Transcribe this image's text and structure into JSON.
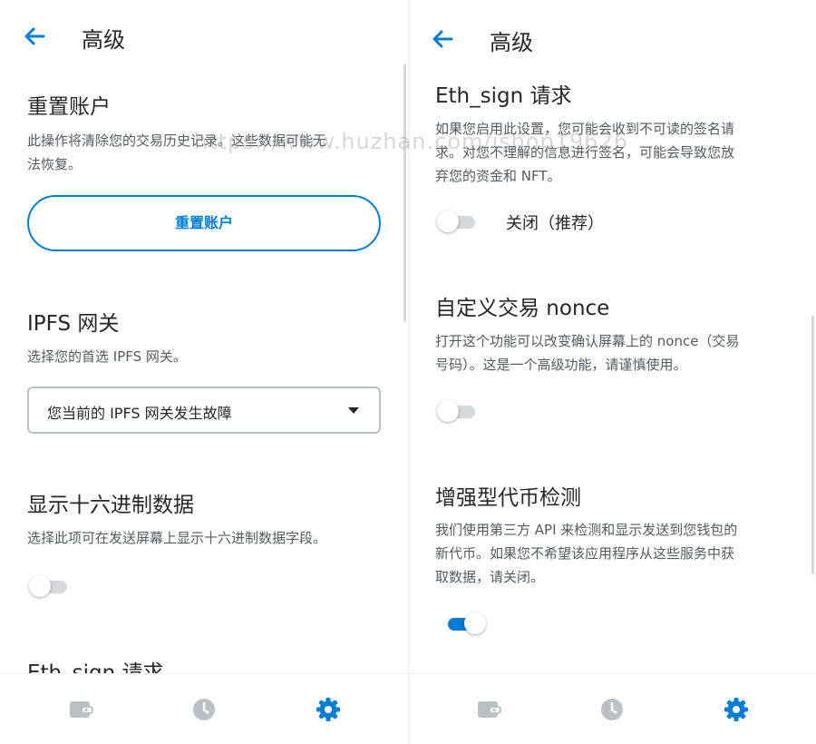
{
  "colors": {
    "accent": "#037dd6",
    "text_primary": "#24272a",
    "text_secondary": "#535a61",
    "toggle_off": "#d6d9dc",
    "tab_inactive": "#bbc0c5"
  },
  "left": {
    "header": {
      "back_icon": "arrow-left-icon",
      "title": "高级"
    },
    "reset": {
      "title": "重置账户",
      "desc_line1": "此操作将清除您的交易历史记录。这些数据可能无",
      "desc_line2": "法恢复。",
      "button_label": "重置账户"
    },
    "ipfs": {
      "title": "IPFS 网关",
      "desc": "选择您的首选 IPFS 网关。",
      "selected": "您当前的 IPFS 网关发生故障"
    },
    "hex": {
      "title": "显示十六进制数据",
      "desc": "选择此项可在发送屏幕上显示十六进制数据字段。",
      "enabled": false
    },
    "eth_sign_peek": {
      "title": "Eth_sign 请求"
    }
  },
  "right": {
    "header": {
      "back_icon": "arrow-left-icon",
      "title": "高级"
    },
    "eth_sign": {
      "title": "Eth_sign 请求",
      "desc_line1": "如果您启用此设置，您可能会收到不可读的签名请",
      "desc_line2": "求。对您不理解的信息进行签名，可能会导致您放",
      "desc_line3": "弃您的资金和 NFT。",
      "toggle_label": "关闭（推荐）",
      "enabled": false
    },
    "nonce": {
      "title": "自定义交易 nonce",
      "desc_line1": "打开这个功能可以改变确认屏幕上的 nonce（交易",
      "desc_line2": "号码）。这是一个高级功能，请谨慎使用。",
      "enabled": false
    },
    "token_detect": {
      "title": "增强型代币检测",
      "desc_line1": "我们使用第三方 API 来检测和显示发送到您钱包的",
      "desc_line2": "新代币。如果您不希望该应用程序从这些服务中获",
      "desc_line3": "取数据，请关闭。",
      "enabled": true
    }
  },
  "tabbar": {
    "tabs": [
      {
        "icon": "wallet-icon",
        "active": false
      },
      {
        "icon": "clock-icon",
        "active": false
      },
      {
        "icon": "gear-icon",
        "active": true
      }
    ]
  },
  "watermark": "https://www.huzhan.com/ishop19626"
}
